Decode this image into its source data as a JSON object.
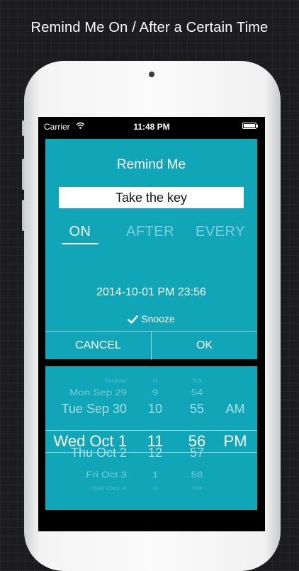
{
  "headline": "Remind Me On / After a Certain Time",
  "status_bar": {
    "carrier": "Carrier",
    "time": "11:48 PM"
  },
  "reminder": {
    "title": "Remind Me",
    "task": "Take the key",
    "modes": [
      "ON",
      "AFTER",
      "EVERY"
    ],
    "selected_mode": "ON",
    "datetime": "2014-10-01 PM 23:56",
    "snooze_label": "Snooze",
    "snooze_checked": true,
    "cancel_label": "CANCEL",
    "ok_label": "OK"
  },
  "picker": {
    "dates": [
      "Today",
      "Mon Sep 29",
      "Tue Sep 30",
      "Wed Oct 1",
      "Thu Oct 2",
      "Fri Oct 3",
      "Sat Oct 4"
    ],
    "hours": [
      "8",
      "9",
      "10",
      "11",
      "12",
      "1",
      "2"
    ],
    "minutes": [
      "53",
      "54",
      "55",
      "56",
      "57",
      "58",
      "59"
    ],
    "ampm": [
      "",
      "",
      "AM",
      "PM",
      "",
      "",
      ""
    ],
    "selected_index": 3
  },
  "colors": {
    "accent": "#10a6b8",
    "background": "#1c1c1e"
  }
}
